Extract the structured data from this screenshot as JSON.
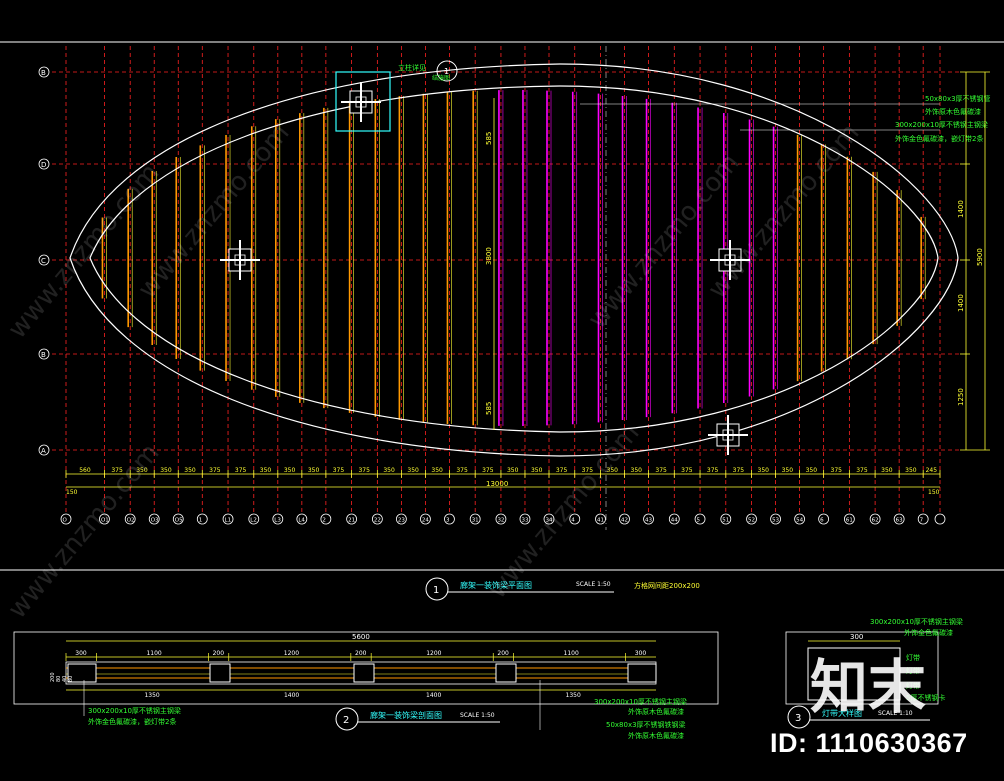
{
  "plan": {
    "title": "廊架一装饰梁平面图",
    "scale": "SCALE 1:50",
    "note": "方格网间距200x200",
    "circle_no": "1",
    "row_labels": [
      "B",
      "D",
      "C",
      "B",
      "A"
    ],
    "col_labels": [
      "O",
      "O1",
      "O2",
      "O3",
      "O5",
      "1",
      "L1",
      "L2",
      "L3",
      "L4",
      "2",
      "21",
      "22",
      "23",
      "24",
      "3",
      "31",
      "32",
      "33",
      "34",
      "4",
      "41",
      "42",
      "43",
      "44",
      "5",
      "51",
      "52",
      "53",
      "54",
      "6",
      "61",
      "62",
      "63",
      "7"
    ],
    "bay_dims": [
      "560",
      "375",
      "350",
      "350",
      "350",
      "375",
      "375",
      "350",
      "350",
      "350",
      "375",
      "375",
      "350",
      "350",
      "350",
      "375",
      "375",
      "350",
      "350",
      "375",
      "375",
      "350",
      "350",
      "375",
      "375",
      "375",
      "375",
      "350",
      "350",
      "350",
      "375",
      "375",
      "350",
      "350",
      "245"
    ],
    "total_dim": "13000",
    "left_edge_dim": "150",
    "right_edge_dim": "150",
    "right_dims": [
      "1400",
      "1400",
      "1250"
    ],
    "right_total": "5900",
    "inner_dims": [
      "585",
      "3800",
      "585"
    ],
    "column_ref": "立柱详见",
    "column_ref_circle": "1",
    "column_ref_sub": "结施图",
    "annotations": [
      "50x80x3厚不锈钢管",
      "外饰原木色氟碳漆",
      "300x200x10厚不锈钢主钢梁",
      "外饰金色氟碳漆，嵌灯带2条"
    ]
  },
  "section": {
    "title": "廊架一装饰梁剖面图",
    "scale": "SCALE 1:50",
    "circle_no": "2",
    "total_dim": "5600",
    "top_dims": [
      "300",
      "1100",
      "200",
      "1200",
      "200",
      "1200",
      "200",
      "1100",
      "300"
    ],
    "bottom_dims": [
      "1350",
      "1400",
      "1400",
      "1350"
    ],
    "height_dims": [
      "200",
      "80",
      "40",
      "80"
    ],
    "annotations_left": [
      "300x200x10厚不锈钢主钢梁",
      "外饰金色氟碳漆，嵌灯带2条"
    ],
    "annotations_right": [
      "300x200x10厚不锈钢主钢梁",
      "外饰原木色氟碳漆",
      "50x80x3厚不锈钢铁钢梁",
      "外饰原木色氟碳漆"
    ]
  },
  "detail": {
    "title": "灯带大样图",
    "scale": "SCALE 1:10",
    "circle_no": "3",
    "width_dim": "300",
    "annotations": [
      "300x200x10厚不锈钢主钢梁",
      "外饰金色氟碳漆",
      "灯带",
      "灯带",
      "灯带",
      "5厚不锈钢卡"
    ]
  },
  "watermark": {
    "text": "www.znzmo.com",
    "logo": "知末",
    "id_label": "ID: 1110630367"
  },
  "colors": {
    "background": "#000000",
    "grid_red": "#ff2222",
    "dim_yellow": "#ffff33",
    "text_green": "#33ff33",
    "magenta": "#ff00ff",
    "orange": "#ff9900",
    "cyan": "#33ffff",
    "white": "#ffffff"
  }
}
